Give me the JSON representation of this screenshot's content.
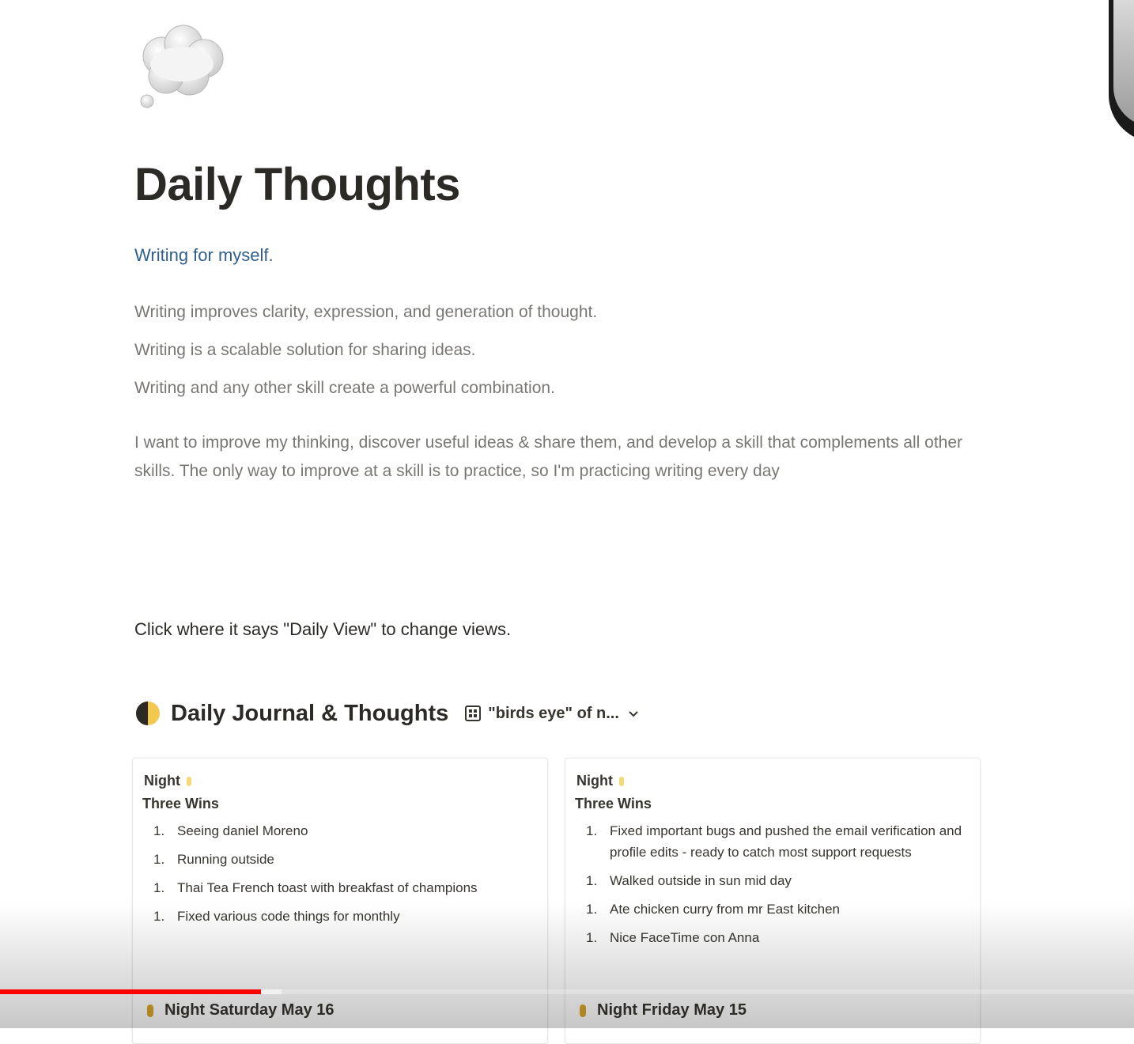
{
  "page": {
    "icon": "thought-balloon-icon",
    "title": "Daily Thoughts",
    "subtitle": "Writing for myself.",
    "paragraphs": [
      "Writing improves clarity, expression, and generation of thought.",
      "Writing is a scalable solution for sharing ideas.",
      "Writing and any other skill create a powerful combination."
    ],
    "long_paragraph": "I want to improve my thinking, discover useful ideas & share them, and develop a skill that complements all other skills. The only way to improve at a skill is to practice, so I'm practicing writing every day",
    "instruction": "Click where it says \"Daily View\" to change views."
  },
  "database": {
    "icon": "half-moon-icon",
    "title": "Daily Journal & Thoughts",
    "view_icon": "gallery-grid-icon",
    "view_label": "\"birds eye\" of n...",
    "cards": [
      {
        "heading": "Night",
        "subheading": "Three Wins",
        "items": [
          {
            "num": "1.",
            "text": "Seeing daniel Moreno"
          },
          {
            "num": "1.",
            "text": "Running outside"
          },
          {
            "num": "1.",
            "text": "Thai Tea French toast with breakfast of champions"
          },
          {
            "num": "1.",
            "text": "Fixed various code things for monthly"
          }
        ],
        "footer": "Night Saturday May 16"
      },
      {
        "heading": "Night",
        "subheading": "Three Wins",
        "items": [
          {
            "num": "1.",
            "text": "Fixed important bugs and pushed the email verification and profile edits - ready to catch most support requests"
          },
          {
            "num": "1.",
            "text": "Walked outside in sun mid day"
          },
          {
            "num": "1.",
            "text": "Ate chicken curry from mr East kitchen"
          },
          {
            "num": "1.",
            "text": "Nice FaceTime con Anna"
          }
        ],
        "footer": "Night Friday May 15"
      }
    ]
  },
  "video_player": {
    "progress_fraction": 0.23,
    "buffered_fraction": 0.248,
    "progress_color": "#ff0000"
  },
  "colors": {
    "subtitle": "#2f5f8a",
    "body_text": "#787774",
    "heading_text": "#2b2a27"
  }
}
